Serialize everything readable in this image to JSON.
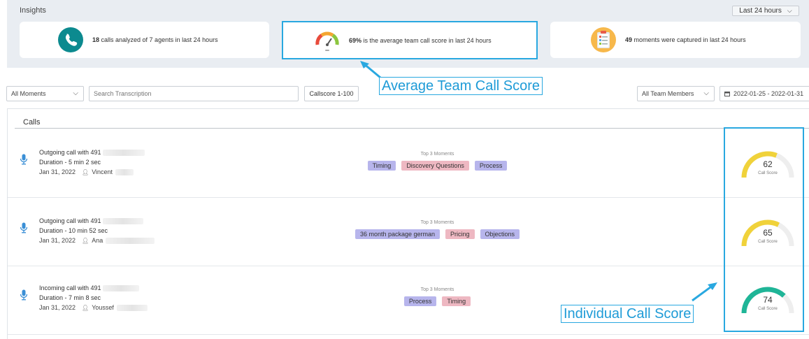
{
  "insights": {
    "title": "Insights",
    "range": "Last 24 hours",
    "cards": [
      {
        "icon": "phone-icon",
        "bold": "18",
        "text": " calls analyzed of 7 agents in last 24 hours"
      },
      {
        "icon": "speedometer-icon",
        "bold": "69%",
        "text": " is the average team call score in last 24 hours"
      },
      {
        "icon": "clipboard-icon",
        "bold": "49",
        "text": " moments were captured in last 24 hours"
      }
    ]
  },
  "filters": {
    "moments": "All Moments",
    "search_placeholder": "Search Transcription",
    "callscore": "Callscore 1-100",
    "team": "All Team Members",
    "date_range": "2022-01-25 - 2022-01-31"
  },
  "calls": {
    "title": "Calls",
    "moments_label": "Top 3 Moments",
    "score_label": "Call Score",
    "rows": [
      {
        "title": "Outgoing call with 491",
        "duration": "Duration - 5 min 2 sec",
        "date": "Jan 31, 2022",
        "agent": "Vincent",
        "tags": [
          {
            "label": "Timing",
            "color": "purple"
          },
          {
            "label": "Discovery Questions",
            "color": "pink"
          },
          {
            "label": "Process",
            "color": "purple"
          }
        ],
        "score": 62,
        "score_color": "#f0d23a"
      },
      {
        "title": "Outgoing call with 491",
        "duration": "Duration - 10 min 52 sec",
        "date": "Jan 31, 2022",
        "agent": "Ana",
        "tags": [
          {
            "label": "36 month package german",
            "color": "purple"
          },
          {
            "label": "Pricing",
            "color": "pink"
          },
          {
            "label": "Objections",
            "color": "purple"
          }
        ],
        "score": 65,
        "score_color": "#f0d23a"
      },
      {
        "title": "Incoming call with 491",
        "duration": "Duration - 7 min 8 sec",
        "date": "Jan 31, 2022",
        "agent": "Youssef",
        "tags": [
          {
            "label": "Process",
            "color": "purple"
          },
          {
            "label": "Timing",
            "color": "pink"
          }
        ],
        "score": 74,
        "score_color": "#1fb597"
      }
    ]
  },
  "annotations": {
    "team_score": "Average Team Call Score",
    "individual_score": "Individual Call Score"
  },
  "colors": {
    "accent": "#29a8e0",
    "gauge_track": "#eeeeee"
  }
}
